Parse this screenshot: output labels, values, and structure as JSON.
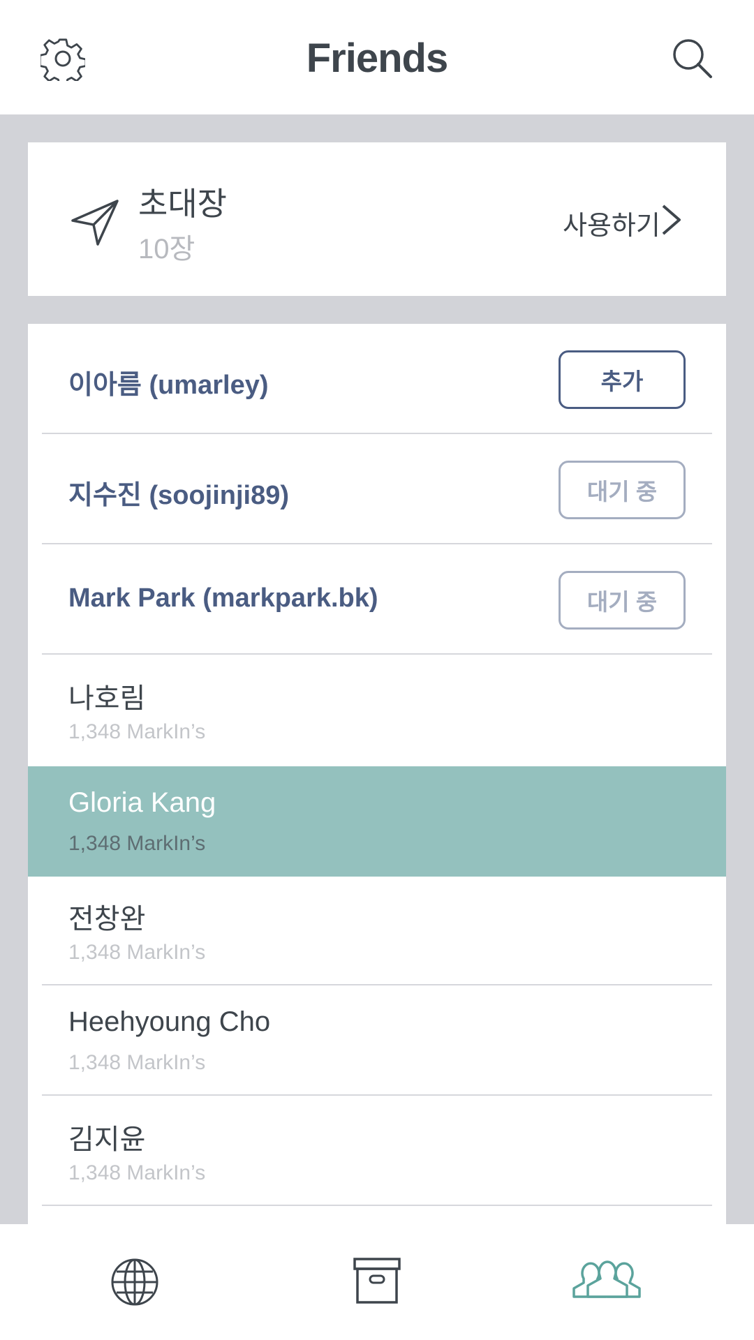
{
  "header": {
    "title": "Friends",
    "left_icon": "gear-icon",
    "right_icon": "search-icon"
  },
  "invite": {
    "title": "초대장",
    "count": "10장",
    "action_label": "사용하기",
    "icon": "paper-plane-icon"
  },
  "requests": [
    {
      "name": "이아름 (umarley)",
      "button": "추가",
      "state": "add"
    },
    {
      "name": "지수진 (soojinji89)",
      "button": "대기 중",
      "state": "pending"
    },
    {
      "name": "Mark Park (markpark.bk)",
      "button": "대기 중",
      "state": "pending"
    }
  ],
  "friends": [
    {
      "name": "나호림",
      "sub": "1,348 MarkIn’s",
      "selected": false
    },
    {
      "name": "Gloria Kang",
      "sub": "1,348 MarkIn’s",
      "selected": true
    },
    {
      "name": "전창완",
      "sub": "1,348 MarkIn’s",
      "selected": false
    },
    {
      "name": "Heehyoung Cho",
      "sub": "1,348 MarkIn’s",
      "selected": false
    },
    {
      "name": "김지윤",
      "sub": "1,348 MarkIn’s",
      "selected": false
    }
  ],
  "tabbar": {
    "tabs": [
      {
        "icon": "globe-icon",
        "active": false
      },
      {
        "icon": "archive-box-icon",
        "active": false
      },
      {
        "icon": "friends-icon",
        "active": true
      }
    ]
  },
  "colors": {
    "text_dark": "#3E454C",
    "accent_blue": "#4A5C82",
    "selected_row": "#94C1BE",
    "tab_active": "#5BA39C",
    "background": "#D2D3D8"
  }
}
